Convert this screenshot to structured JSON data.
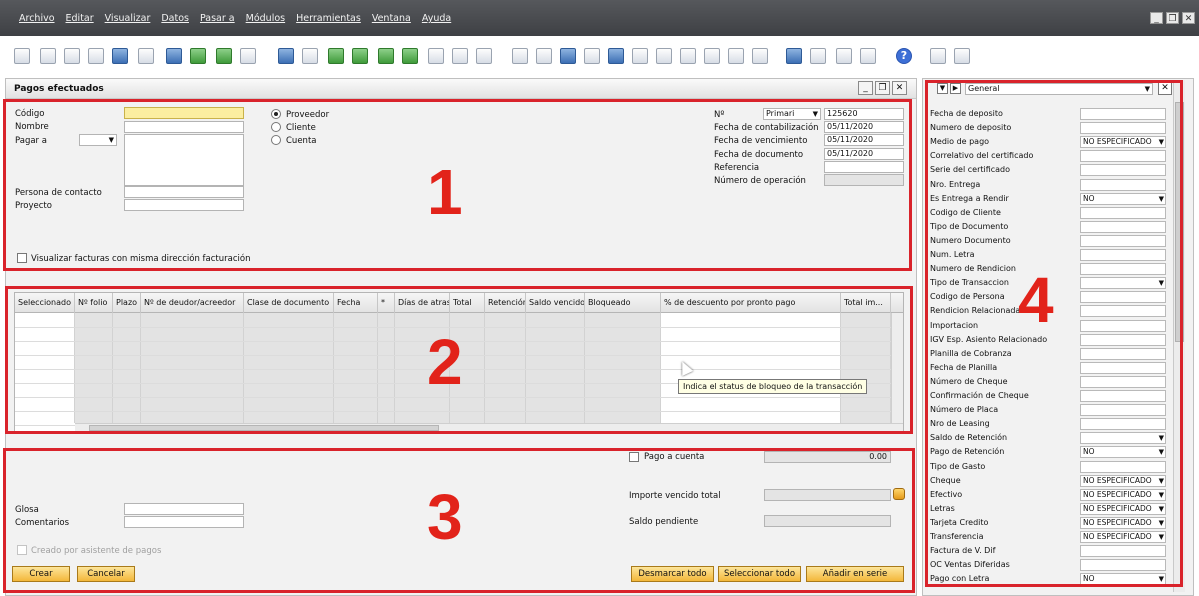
{
  "menu": {
    "items": [
      "Archivo",
      "Editar",
      "Visualizar",
      "Datos",
      "Pasar a",
      "Módulos",
      "Herramientas",
      "Ventana",
      "Ayuda"
    ]
  },
  "toolbar": {
    "icons": [
      "preview-icon",
      "print-icon",
      "email-icon",
      "export-icon",
      "excel-icon",
      "pdf-icon",
      "word-icon",
      "launch-icon",
      "tree-icon",
      "filter-icon",
      "find-icon",
      "add-icon",
      "first-record-icon",
      "previous-record-icon",
      "next-record-icon",
      "last-record-icon",
      "refresh-icon",
      "funnel-icon",
      "sort-icon",
      "base-document-icon",
      "target-document-icon",
      "journal-icon",
      "gross-profit-icon",
      "payment-icon",
      "layout-icon",
      "settings-icon",
      "query-icon",
      "approve-icon",
      "document-icon",
      "edit-icon",
      "table-icon",
      "message-icon",
      "calculator-icon",
      "org-icon",
      "help-icon",
      "window-icon",
      "window2-icon"
    ]
  },
  "form": {
    "title": "Pagos efectuados",
    "codigo_label": "Código",
    "nombre_label": "Nombre",
    "pagar_a_label": "Pagar a",
    "persona_contacto_label": "Persona de contacto",
    "proyecto_label": "Proyecto",
    "radio_proveedor": "Proveedor",
    "radio_cliente": "Cliente",
    "radio_cuenta": "Cuenta",
    "no_label": "Nº",
    "series_value": "Primari",
    "doc_number": "125620",
    "fecha_contab_label": "Fecha de contabilización",
    "fecha_contab_value": "05/11/2020",
    "fecha_venc_label": "Fecha de vencimiento",
    "fecha_venc_value": "05/11/2020",
    "fecha_doc_label": "Fecha de documento",
    "fecha_doc_value": "05/11/2020",
    "referencia_label": "Referencia",
    "num_operacion_label": "Número de operación",
    "visualizar_facturas_label": "Visualizar facturas con misma dirección facturación"
  },
  "grid": {
    "columns": [
      "Seleccionado",
      "Nº folio",
      "Plazo",
      "Nº de deudor/acreedor",
      "Clase de documento",
      "Fecha",
      "*",
      "Días de atraso",
      "Total",
      "Retención",
      "Saldo vencido",
      "Bloqueado",
      "% de descuento por pronto pago",
      "Total im..."
    ],
    "tooltip": "Indica el status de bloqueo de la transacción"
  },
  "bottom": {
    "pago_a_cuenta_label": "Pago a cuenta",
    "pago_a_cuenta_value": "0.00",
    "importe_vencido_label": "Importe vencido total",
    "saldo_pendiente_label": "Saldo pendiente",
    "glosa_label": "Glosa",
    "comentarios_label": "Comentarios",
    "creado_asistente_label": "Creado por asistente de pagos",
    "crear_button": "Crear",
    "cancelar_button": "Cancelar",
    "desmarcar_button": "Desmarcar todo",
    "seleccionar_button": "Seleccionar todo",
    "anadir_button": "Añadir en serie"
  },
  "side": {
    "category": "General",
    "fields": [
      {
        "label": "Fecha de deposito",
        "value": ""
      },
      {
        "label": "Numero de deposito",
        "value": ""
      },
      {
        "label": "Medio de pago",
        "value": "NO ESPECIFICADO",
        "dropdown": true
      },
      {
        "label": "Correlativo del certificado",
        "value": ""
      },
      {
        "label": "Serie del certificado",
        "value": ""
      },
      {
        "label": "Nro. Entrega",
        "value": ""
      },
      {
        "label": "Es Entrega a Rendir",
        "value": "NO",
        "dropdown": true
      },
      {
        "label": "Codigo de Cliente",
        "value": ""
      },
      {
        "label": "Tipo de Documento",
        "value": ""
      },
      {
        "label": "Numero Documento",
        "value": ""
      },
      {
        "label": "Num. Letra",
        "value": ""
      },
      {
        "label": "Numero de Rendicion",
        "value": ""
      },
      {
        "label": "Tipo de Transaccion",
        "value": "",
        "dropdown": true
      },
      {
        "label": "Codigo de Persona",
        "value": ""
      },
      {
        "label": "Rendicion Relacionada",
        "value": ""
      },
      {
        "label": "Importacion",
        "value": ""
      },
      {
        "label": "IGV Esp. Asiento Relacionado",
        "value": ""
      },
      {
        "label": "Planilla de Cobranza",
        "value": ""
      },
      {
        "label": "Fecha de Planilla",
        "value": ""
      },
      {
        "label": "Número de Cheque",
        "value": ""
      },
      {
        "label": "Confirmación de Cheque",
        "value": ""
      },
      {
        "label": "Número de Placa",
        "value": ""
      },
      {
        "label": "Nro de Leasing",
        "value": ""
      },
      {
        "label": "Saldo de Retención",
        "value": "",
        "dropdown": true
      },
      {
        "label": "Pago de Retención",
        "value": "NO",
        "dropdown": true
      },
      {
        "label": "Tipo de Gasto",
        "value": ""
      },
      {
        "label": "Cheque",
        "value": "NO ESPECIFICADO",
        "dropdown": true
      },
      {
        "label": "Efectivo",
        "value": "NO ESPECIFICADO",
        "dropdown": true
      },
      {
        "label": "Letras",
        "value": "NO ESPECIFICADO",
        "dropdown": true
      },
      {
        "label": "Tarjeta Credito",
        "value": "NO ESPECIFICADO",
        "dropdown": true
      },
      {
        "label": "Transferencia",
        "value": "NO ESPECIFICADO",
        "dropdown": true
      },
      {
        "label": "Factura de V. Dif",
        "value": ""
      },
      {
        "label": "OC Ventas Diferidas",
        "value": ""
      },
      {
        "label": "Pago con Letra",
        "value": "NO",
        "dropdown": true
      }
    ]
  },
  "annotations": [
    "1",
    "2",
    "3",
    "4"
  ],
  "colors": {
    "annotation_red": "#d9232b",
    "button_yellow": "#f3b73a",
    "menubar": "#4a4c50"
  }
}
